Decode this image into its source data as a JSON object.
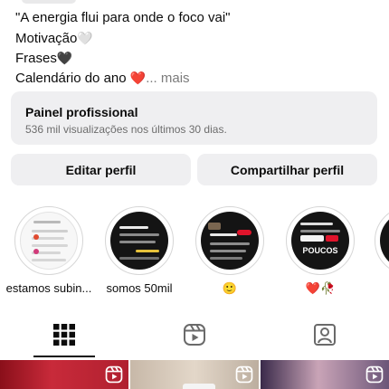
{
  "bio": {
    "lines": [
      {
        "text": "\"A energia flui para onde o foco vai\"",
        "emoji": ""
      },
      {
        "text": "Motivação",
        "emoji": "🤍"
      },
      {
        "text": "Frases",
        "emoji": "🖤"
      },
      {
        "text": "Calendário do ano ",
        "emoji": "❤️"
      }
    ],
    "more_label": "... mais"
  },
  "professional_panel": {
    "title": "Painel profissional",
    "subtitle": "536 mil visualizações nos últimos 30 dias."
  },
  "buttons": {
    "edit_profile": "Editar perfil",
    "share_profile": "Compartilhar perfil"
  },
  "highlights": [
    {
      "label": "estamos subin..."
    },
    {
      "label": "somos 50mil"
    },
    {
      "label": "🙂"
    },
    {
      "label": "❤️🥀",
      "cover_text": "POUCOS"
    }
  ],
  "tabs": [
    {
      "icon": "grid-icon",
      "selected": true
    },
    {
      "icon": "reels-icon",
      "selected": false
    },
    {
      "icon": "tagged-icon",
      "selected": false
    }
  ],
  "colors": {
    "panel_bg": "#efeff1",
    "text": "#0c0c0c",
    "muted": "#6d6d6d",
    "accent_red": "#e0142b"
  }
}
